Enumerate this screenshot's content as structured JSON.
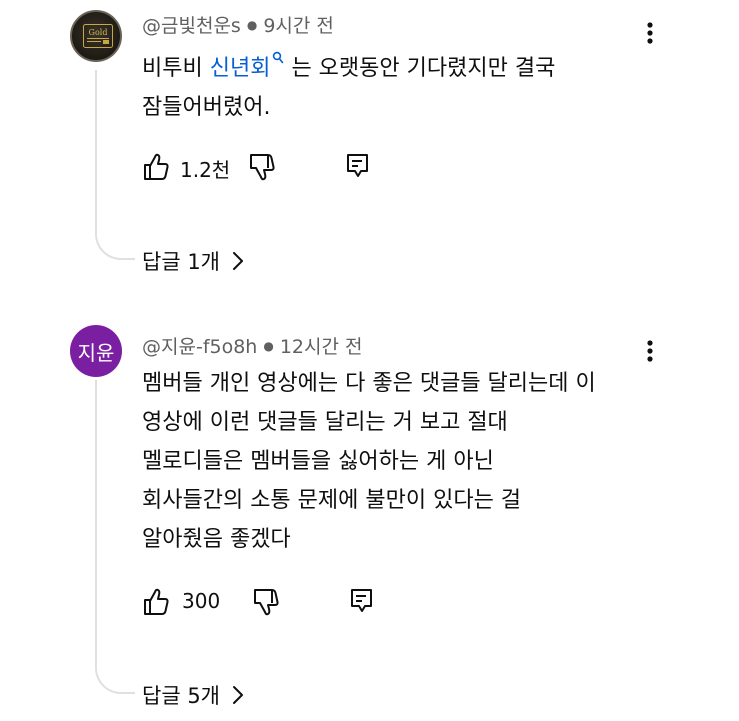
{
  "comments": [
    {
      "author": "@금빛천운s",
      "time": "9시간 전",
      "avatar_logo_text": "Gold",
      "text_before": "비투비 ",
      "tag": "신년회",
      "text_after": " 는 오랫동안 기다렸지만 결국",
      "text_line2": "잠들어버렸어.",
      "likes": "1.2천",
      "replies": "답글 1개"
    },
    {
      "author": "@지윤-f5o8h",
      "time": "12시간 전",
      "avatar_text": "지윤",
      "lines": [
        "멤버들 개인 영상에는 다 좋은 댓글들 달리는데 이",
        "영상에 이런 댓글들 달리는 거 보고 절대",
        "멜로디들은 멤버들을 싫어하는 게 아닌",
        "회사들간의 소통 문제에 불만이 있다는 걸",
        "알아줬음 좋겠다"
      ],
      "likes": "300",
      "replies": "답글 5개"
    }
  ],
  "icons": {
    "like": "thumbs-up-icon",
    "dislike": "thumbs-down-icon",
    "reply": "reply-icon",
    "more": "more-vert-icon",
    "chevron": "chevron-right-icon",
    "search": "search-icon"
  },
  "colors": {
    "link": "#065fd4",
    "meta": "#606060",
    "avatar_purple": "#7b1fa2"
  }
}
